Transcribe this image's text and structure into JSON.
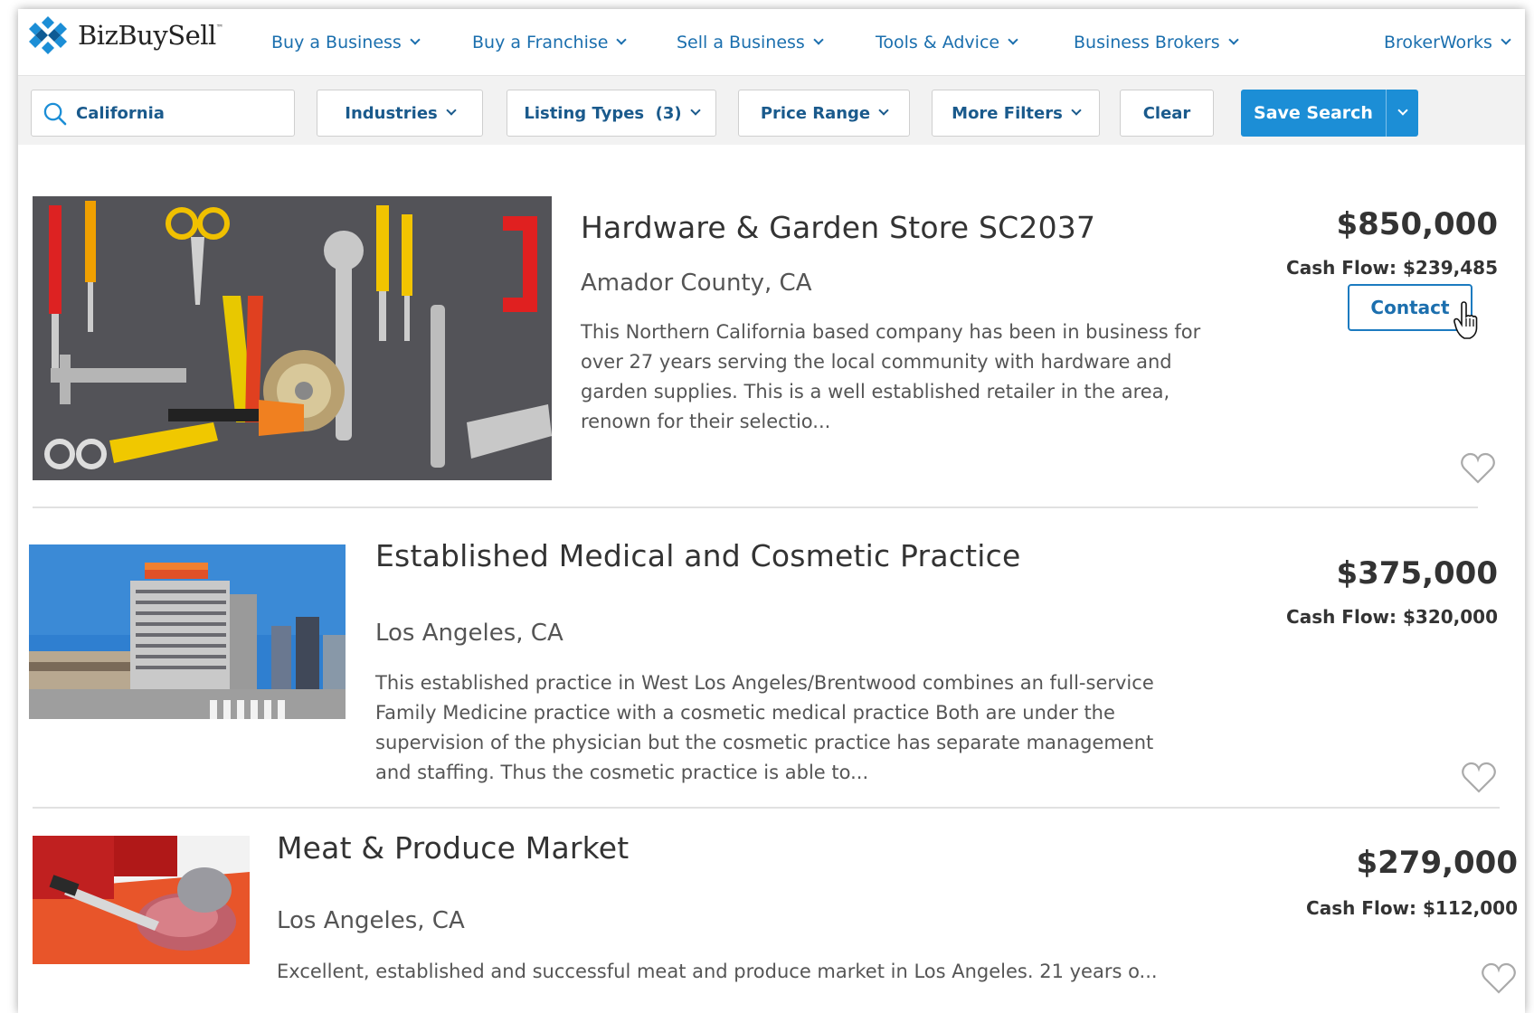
{
  "brand": {
    "name": "BizBuySell",
    "tm": "™"
  },
  "nav": {
    "items": [
      {
        "label": "Buy a Business"
      },
      {
        "label": "Buy a Franchise"
      },
      {
        "label": "Sell a Business"
      },
      {
        "label": "Tools & Advice"
      },
      {
        "label": "Business Brokers"
      },
      {
        "label": "BrokerWorks"
      }
    ]
  },
  "filters": {
    "search_value": "California",
    "industries": "Industries",
    "listing_types": "Listing Types  (3)",
    "price_range": "Price Range",
    "more_filters": "More Filters",
    "clear": "Clear",
    "save_search": "Save Search"
  },
  "listings": [
    {
      "title": "Hardware & Garden Store SC2037",
      "location": "Amador County, CA",
      "description": "This Northern California based company has been in business for over 27 years serving the local community with hardware and garden supplies. This is a well established retailer in the area, renown for their selectio...",
      "price": "$850,000",
      "cash_flow": "Cash Flow: $239,485",
      "contact_label": "Contact"
    },
    {
      "title": "Established Medical and Cosmetic Practice",
      "location": "Los Angeles, CA",
      "description": "This established practice in West Los Angeles/Brentwood combines an full-service Family Medicine practice with a cosmetic medical practice Both are under the supervision of the physician but the cosmetic practice has separate management and staffing. Thus the cosmetic practice is able to...",
      "price": "$375,000",
      "cash_flow": "Cash Flow: $320,000"
    },
    {
      "title": "Meat & Produce Market",
      "location": "Los Angeles, CA",
      "description": "Excellent, established and successful meat and produce market in Los Angeles. 21 years o...",
      "price": "$279,000",
      "cash_flow": "Cash Flow: $112,000"
    }
  ],
  "colors": {
    "link_blue": "#1b6fae",
    "primary_button": "#1c8ed6",
    "filter_bar_bg": "#f2f2f2"
  }
}
